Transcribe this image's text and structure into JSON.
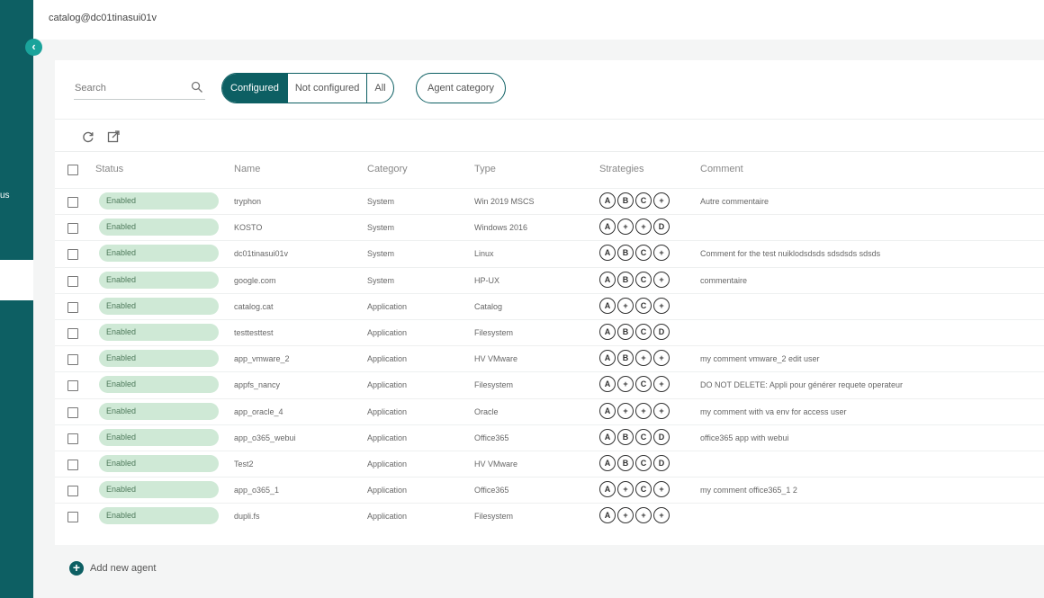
{
  "topbar": {
    "title": "catalog@dc01tinasui01v"
  },
  "sidebar": {
    "fragment": "us"
  },
  "search": {
    "placeholder": "Search"
  },
  "filters": {
    "options": [
      "Configured",
      "Not configured",
      "All"
    ],
    "selected": "Configured"
  },
  "agent_category_label": "Agent category",
  "table": {
    "headers": [
      "Status",
      "Name",
      "Category",
      "Type",
      "Strategies",
      "Comment"
    ],
    "rows": [
      {
        "status": "Enabled",
        "name": "tryphon",
        "category": "System",
        "type": "Win 2019 MSCS",
        "strategies": [
          "A",
          "B",
          "C",
          "+"
        ],
        "comment": "Autre commentaire"
      },
      {
        "status": "Enabled",
        "name": "KOSTO",
        "category": "System",
        "type": "Windows 2016",
        "strategies": [
          "A",
          "+",
          "+",
          "D"
        ],
        "comment": ""
      },
      {
        "status": "Enabled",
        "name": "dc01tinasui01v",
        "category": "System",
        "type": "Linux",
        "strategies": [
          "A",
          "B",
          "C",
          "+"
        ],
        "comment": "Comment for the test nuiklodsdsds sdsdsds sdsds"
      },
      {
        "status": "Enabled",
        "name": "google.com",
        "category": "System",
        "type": "HP-UX",
        "strategies": [
          "A",
          "B",
          "C",
          "+"
        ],
        "comment": "commentaire"
      },
      {
        "status": "Enabled",
        "name": "catalog.cat",
        "category": "Application",
        "type": "Catalog",
        "strategies": [
          "A",
          "+",
          "C",
          "+"
        ],
        "comment": ""
      },
      {
        "status": "Enabled",
        "name": "testtesttest",
        "category": "Application",
        "type": "Filesystem",
        "strategies": [
          "A",
          "B",
          "C",
          "D"
        ],
        "comment": ""
      },
      {
        "status": "Enabled",
        "name": "app_vmware_2",
        "category": "Application",
        "type": "HV VMware",
        "strategies": [
          "A",
          "B",
          "+",
          "+"
        ],
        "comment": "my comment vmware_2 edit user"
      },
      {
        "status": "Enabled",
        "name": "appfs_nancy",
        "category": "Application",
        "type": "Filesystem",
        "strategies": [
          "A",
          "+",
          "C",
          "+"
        ],
        "comment": "DO NOT DELETE: Appli pour générer requete operateur"
      },
      {
        "status": "Enabled",
        "name": "app_oracle_4",
        "category": "Application",
        "type": "Oracle",
        "strategies": [
          "A",
          "+",
          "+",
          "+"
        ],
        "comment": "my comment with va env for access user"
      },
      {
        "status": "Enabled",
        "name": "app_o365_webui",
        "category": "Application",
        "type": "Office365",
        "strategies": [
          "A",
          "B",
          "C",
          "D"
        ],
        "comment": "office365 app with webui"
      },
      {
        "status": "Enabled",
        "name": "Test2",
        "category": "Application",
        "type": "HV VMware",
        "strategies": [
          "A",
          "B",
          "C",
          "D"
        ],
        "comment": ""
      },
      {
        "status": "Enabled",
        "name": "app_o365_1",
        "category": "Application",
        "type": "Office365",
        "strategies": [
          "A",
          "+",
          "C",
          "+"
        ],
        "comment": "my comment office365_1 2"
      },
      {
        "status": "Enabled",
        "name": "dupli.fs",
        "category": "Application",
        "type": "Filesystem",
        "strategies": [
          "A",
          "+",
          "+",
          "+"
        ],
        "comment": ""
      }
    ]
  },
  "add_agent_label": "Add new agent",
  "colors": {
    "primary": "#0d5f63",
    "accent": "#1aa39b",
    "enabled_bg": "#cfe9d6"
  },
  "icons": [
    "chevron-left-icon",
    "search-icon",
    "refresh-icon",
    "export-icon",
    "plus-icon"
  ]
}
